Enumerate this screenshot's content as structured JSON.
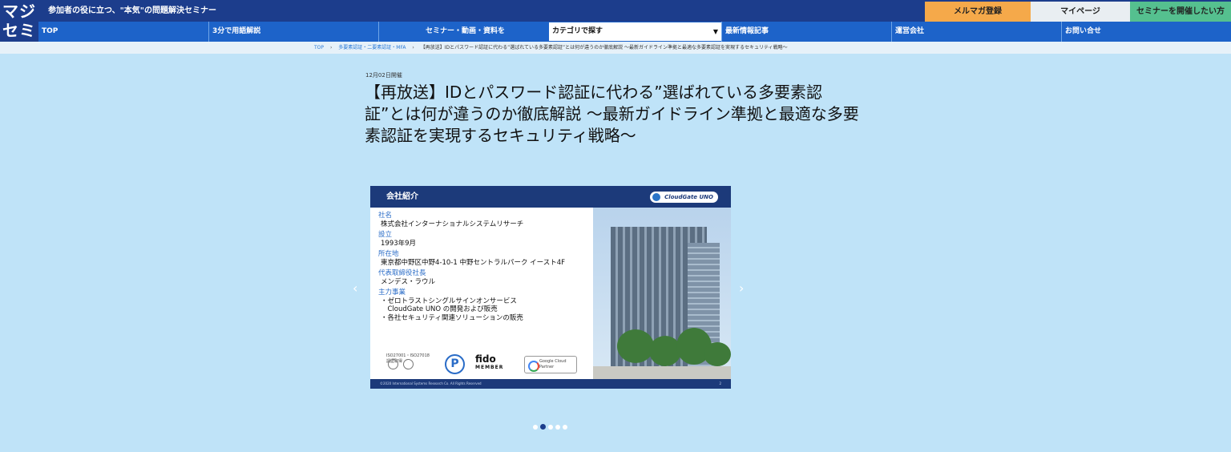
{
  "logo": {
    "line1": "マジ",
    "line2": "セミ"
  },
  "header": {
    "tagline": "参加者の役に立つ、\"本気\"の問題解決セミナー",
    "mail_label": "メルマガ登録",
    "mypage_label": "マイページ",
    "host_label": "セミナーを開催したい方"
  },
  "nav": {
    "items": [
      "TOP",
      "3分で用語解説",
      "セミナー・動画・資料を",
      "最新情報記事",
      "運営会社",
      "お問い合せ"
    ],
    "category_select": "カテゴリで探す"
  },
  "breadcrumb": {
    "top": "TOP",
    "category": "多要素認証・二要素認証・MFA",
    "current": "【再放送】IDとパスワード認証に代わる”選ばれている多要素認証”とは何が違うのか徹底解説 ～最新ガイドライン準拠と最適な多要素認証を実現するセキュリティ戦略～",
    "separator": "›"
  },
  "event": {
    "date": "12月02日開催",
    "title": "【再放送】IDとパスワード認証に代わる”選ばれている多要素認証”とは何が違うのか徹底解説 ～最新ガイドライン準拠と最適な多要素認証を実現するセキュリティ戦略～"
  },
  "slide": {
    "heading": "会社紹介",
    "brand_logo": "CloudGate UNO",
    "fields": [
      {
        "label": "社名",
        "value": "株式会社インターナショナルシステムリサーチ"
      },
      {
        "label": "設立",
        "value": "1993年9月"
      },
      {
        "label": "所在地",
        "value": "東京都中野区中野4-10-1 中野セントラルパーク イースト4F"
      },
      {
        "label": "代表取締役社長",
        "value": "メンデス・ラウル"
      }
    ],
    "business_label": "主力事業",
    "business_items": [
      "・ゼロトラストシングルサインオンサービス",
      "　CloudGate UNO の開発および販売",
      "・各社セキュリティ関連ソリューションの販売"
    ],
    "cert_label": "ISO27001・ISO27018 認証取得",
    "pmark": "P",
    "fido_text": "fido",
    "fido_sub": "MEMBER",
    "gcloud_text": "Google Cloud",
    "gcloud_sub": "Partner",
    "footer_text": "©2020 International Systems Research Co. All Rights Reserved",
    "page_num": "2"
  },
  "carousel": {
    "prev": "‹",
    "next": "›",
    "count": 5,
    "active": 1
  },
  "colors": {
    "header": "#1c3d8c",
    "nav": "#1d63c9",
    "background": "#bfe3f8",
    "mail": "#f5a94a",
    "host": "#55c08f"
  }
}
